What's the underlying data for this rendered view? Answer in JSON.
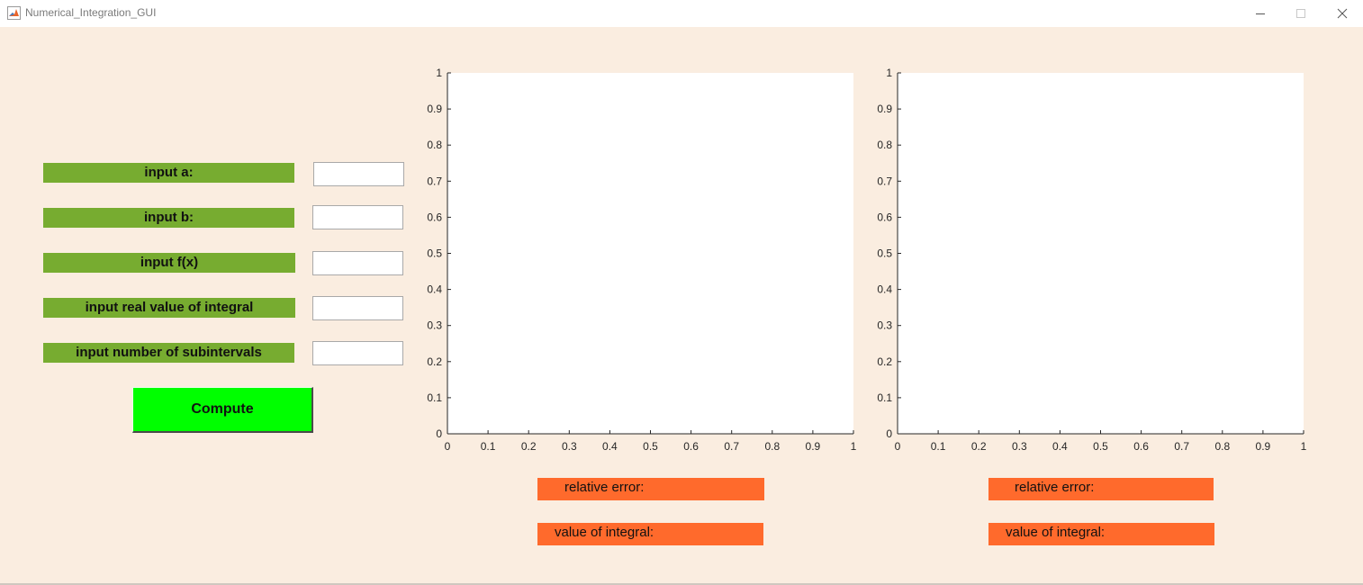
{
  "window": {
    "title": "Numerical_Integration_GUI",
    "controls": [
      "minimize-icon",
      "maximize-icon",
      "close-icon"
    ]
  },
  "inputs": [
    {
      "label": "input a:",
      "value": "",
      "placeholder": ""
    },
    {
      "label": "input b:",
      "value": "",
      "placeholder": ""
    },
    {
      "label": "input f(x)",
      "value": "",
      "placeholder": ""
    },
    {
      "label": "input real value of integral",
      "value": "",
      "placeholder": ""
    },
    {
      "label": "input number of subintervals",
      "value": "",
      "placeholder": ""
    }
  ],
  "compute_button": {
    "label": "Compute"
  },
  "results": [
    {
      "relative_error_label": "relative error:",
      "integral_label": "value of integral:"
    },
    {
      "relative_error_label": "relative error:",
      "integral_label": "value of integral:"
    }
  ],
  "colors": {
    "background": "#faede0",
    "input_label": "#77ac30",
    "compute_button": "#00ff00",
    "result_label": "#ff6a2c"
  },
  "chart_data": [
    {
      "type": "line",
      "series": [],
      "xlim": [
        0,
        1
      ],
      "ylim": [
        0,
        1
      ],
      "x_ticks": [
        "0",
        "0.1",
        "0.2",
        "0.3",
        "0.4",
        "0.5",
        "0.6",
        "0.7",
        "0.8",
        "0.9",
        "1"
      ],
      "y_ticks": [
        "0",
        "0.1",
        "0.2",
        "0.3",
        "0.4",
        "0.5",
        "0.6",
        "0.7",
        "0.8",
        "0.9",
        "1"
      ],
      "grid": false
    },
    {
      "type": "line",
      "series": [],
      "xlim": [
        0,
        1
      ],
      "ylim": [
        0,
        1
      ],
      "x_ticks": [
        "0",
        "0.1",
        "0.2",
        "0.3",
        "0.4",
        "0.5",
        "0.6",
        "0.7",
        "0.8",
        "0.9",
        "1"
      ],
      "y_ticks": [
        "0",
        "0.1",
        "0.2",
        "0.3",
        "0.4",
        "0.5",
        "0.6",
        "0.7",
        "0.8",
        "0.9",
        "1"
      ],
      "grid": false
    }
  ]
}
